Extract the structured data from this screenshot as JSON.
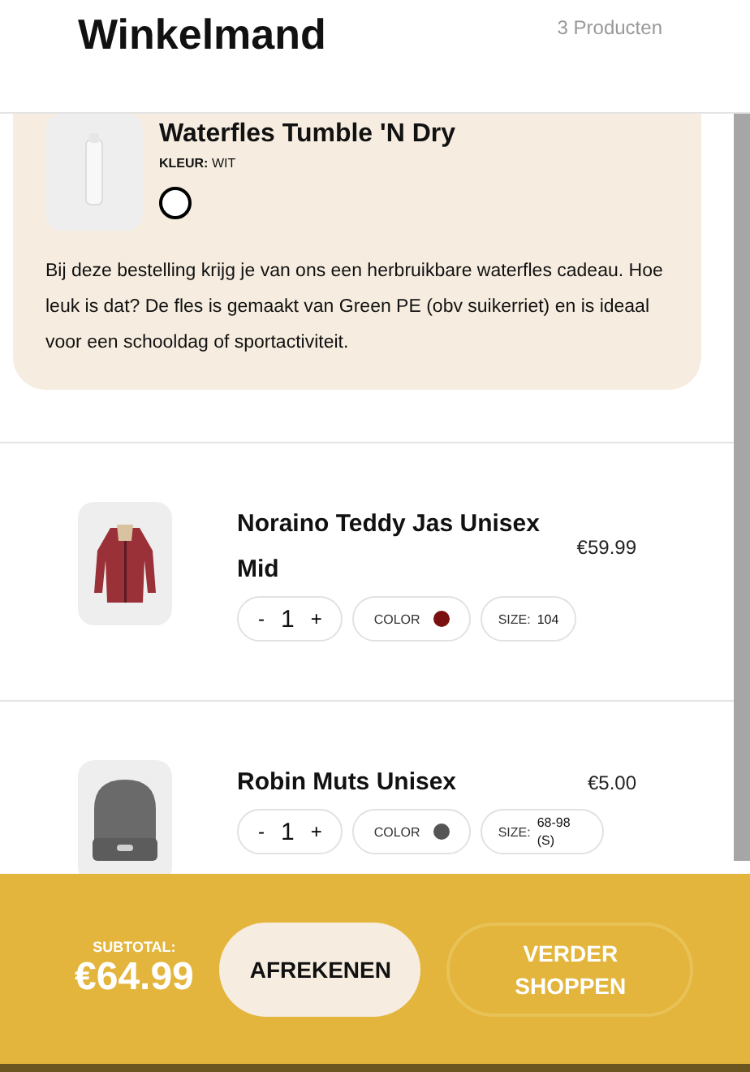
{
  "header": {
    "title": "Winkelmand",
    "count": "3 Producten"
  },
  "gift": {
    "title": "Waterfles Tumble 'N Dry",
    "color_label": "KLEUR:",
    "color_name": "WIT",
    "color": "#ffffff",
    "description": "Bij deze bestelling krijg je van ons een herbruikbare waterfles cadeau. Hoe leuk is dat? De fles is gemaakt van Green PE (obv suikerriet) en is ideaal voor een schooldag of sportactiviteit."
  },
  "items": [
    {
      "name": "Noraino Teddy Jas Unisex Mid",
      "price": "€59.99",
      "quantity": "1",
      "color_label": "COLOR",
      "color": "#7a1010",
      "size_label": "SIZE:",
      "size": "104",
      "minus": "-",
      "plus": "+"
    },
    {
      "name": "Robin Muts Unisex",
      "price": "€5.00",
      "quantity": "1",
      "color_label": "COLOR",
      "color": "#555555",
      "size_label": "SIZE:",
      "size": "68-98 (S)",
      "minus": "-",
      "plus": "+"
    }
  ],
  "footer": {
    "subtotal_label": "SUBTOTAL:",
    "subtotal": "€64.99",
    "buttons": [
      "AFREKENEN",
      "VERDER SHOPPEN"
    ]
  }
}
